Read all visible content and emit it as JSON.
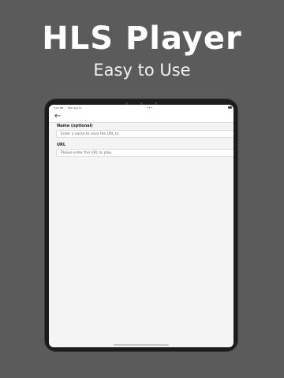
{
  "promo": {
    "title": "HLS Player",
    "subtitle": "Easy to Use"
  },
  "status_bar": {
    "time": "9:41 PM",
    "date": "Mon Sep 11",
    "center": "•••"
  },
  "form": {
    "name_label": "Name (optional)",
    "name_placeholder": "Enter a name to save the URL to",
    "url_label": "URL",
    "url_placeholder": "Please enter the URL to play"
  },
  "icons": {
    "back": "back-arrow-icon"
  }
}
